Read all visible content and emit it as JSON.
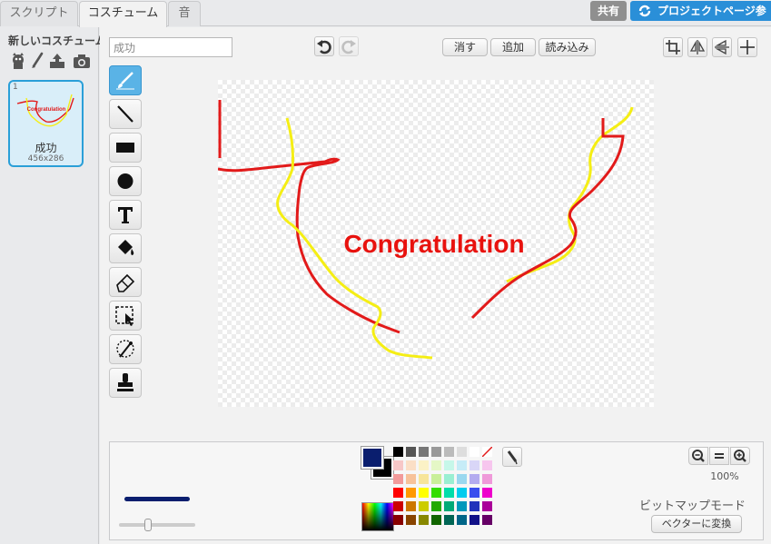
{
  "tabs": {
    "script": "スクリプト",
    "costume": "コスチューム",
    "sound": "音"
  },
  "header": {
    "share": "共有",
    "project_page": "プロジェクトページ参"
  },
  "left": {
    "new_costume": "新しいコスチューム:",
    "costume_number": "1",
    "costume_name": "成功",
    "costume_size": "456x286"
  },
  "editor": {
    "name_value": "成功",
    "clear": "消す",
    "add": "追加",
    "import": "読み込み"
  },
  "canvas": {
    "text": "Congratulation",
    "text_color": "#e8120e",
    "stroke_red": "#e21a1a",
    "stroke_yellow": "#f5ee14"
  },
  "bottom": {
    "zoom": "100%",
    "mode": "ビットマップモード",
    "convert": "ベクターに変換",
    "primary_color": "#0a1e6e",
    "secondary_color": "#000000",
    "palette": [
      "#000000",
      "#555555",
      "#777777",
      "#999999",
      "#bbbbbb",
      "#dddddd",
      "#ffffff",
      "none",
      "#f7c7c7",
      "#fbdfc6",
      "#fbf2c6",
      "#e5f7c6",
      "#c6f7e9",
      "#c6ecf7",
      "#d9d6f7",
      "#f7c6ee",
      "#f29a9a",
      "#f7c29a",
      "#f7e59a",
      "#c9ef9a",
      "#9aefd2",
      "#9ad8ef",
      "#b3abef",
      "#ef9ad9",
      "#ff0000",
      "#ff9900",
      "#ffff00",
      "#33dd00",
      "#00ddaa",
      "#00ccee",
      "#3a4eee",
      "#ee00cc",
      "#cc0000",
      "#cc7700",
      "#cccc00",
      "#22aa00",
      "#00aa77",
      "#0099bb",
      "#2233bb",
      "#aa0099",
      "#880000",
      "#884400",
      "#888800",
      "#116600",
      "#006655",
      "#006688",
      "#111188",
      "#660066"
    ]
  }
}
